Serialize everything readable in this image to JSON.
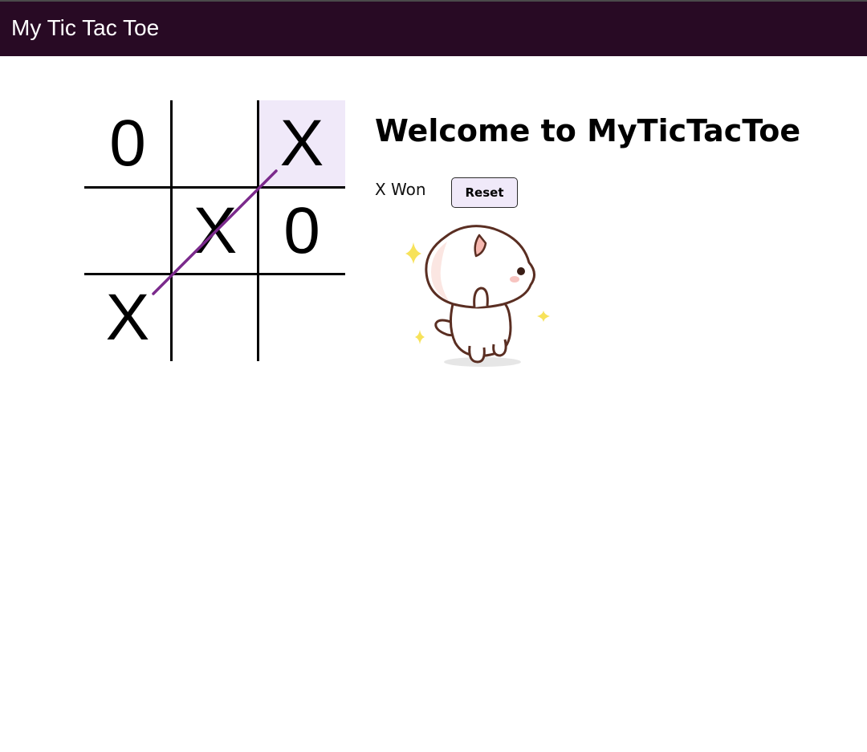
{
  "app_bar": {
    "title": "My Tic Tac Toe",
    "background_color": "#280a24"
  },
  "board": {
    "cells": [
      {
        "mark": "0",
        "highlighted": false
      },
      {
        "mark": "",
        "highlighted": false
      },
      {
        "mark": "X",
        "highlighted": true
      },
      {
        "mark": "",
        "highlighted": false
      },
      {
        "mark": "X",
        "highlighted": false
      },
      {
        "mark": "0",
        "highlighted": false
      },
      {
        "mark": "X",
        "highlighted": false
      },
      {
        "mark": "",
        "highlighted": false
      },
      {
        "mark": "",
        "highlighted": false
      }
    ],
    "winning_line_color": "#7b2a8c",
    "highlight_color": "#f0e9f9"
  },
  "header": {
    "welcome": "Welcome to MyTicTacToe"
  },
  "status": {
    "text": "X Won"
  },
  "controls": {
    "reset_label": "Reset"
  },
  "illustration": {
    "icon": "celebrating-cat-icon"
  }
}
